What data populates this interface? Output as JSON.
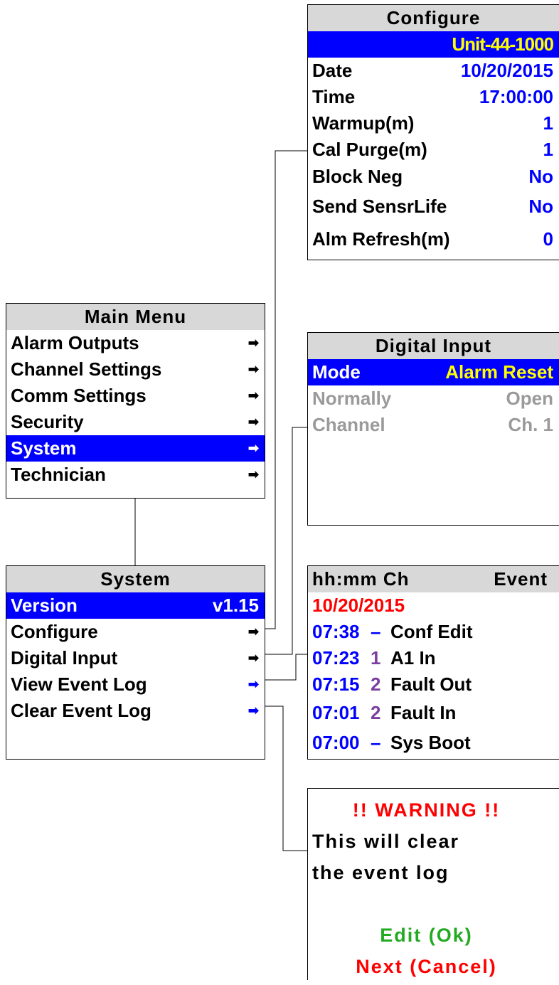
{
  "configure": {
    "title": "Configure",
    "unit_id": "Unit-44-1000",
    "rows": [
      {
        "label": "Date",
        "value": "10/20/2015"
      },
      {
        "label": "Time",
        "value": "17:00:00"
      },
      {
        "label": "Warmup(m)",
        "value": "1"
      },
      {
        "label": "Cal Purge(m)",
        "value": "1"
      },
      {
        "label": "Block Neg",
        "value": "No"
      },
      {
        "label": "Send SensrLife",
        "value": "No"
      },
      {
        "label": "Alm Refresh(m)",
        "value": "0"
      }
    ]
  },
  "main_menu": {
    "title": "Main Menu",
    "items": [
      {
        "label": "Alarm Outputs",
        "arrow": "➡"
      },
      {
        "label": "Channel Settings",
        "arrow": "➡"
      },
      {
        "label": "Comm Settings",
        "arrow": "➡"
      },
      {
        "label": "Security",
        "arrow": "➡"
      },
      {
        "label": "System",
        "arrow": "➡"
      },
      {
        "label": "Technician",
        "arrow": "➡"
      }
    ]
  },
  "system_menu": {
    "title": "System",
    "version_label": "Version",
    "version_value": "v1.15",
    "items": [
      {
        "label": "Configure",
        "arrow": "➡"
      },
      {
        "label": "Digital Input",
        "arrow": "➡"
      },
      {
        "label": "View Event Log",
        "arrow": "➡"
      },
      {
        "label": "Clear Event Log",
        "arrow": "➡"
      }
    ]
  },
  "digital_input": {
    "title": "Digital Input",
    "mode_label": "Mode",
    "mode_value": "Alarm Reset",
    "normally_label": "Normally",
    "normally_value": "Open",
    "channel_label": "Channel",
    "channel_value": "Ch. 1"
  },
  "event_log": {
    "header_left": "hh:mm Ch",
    "header_right": "Event",
    "date": "10/20/2015",
    "entries": [
      {
        "time": "07:38",
        "ch": "–",
        "event": "Conf Edit"
      },
      {
        "time": "07:23",
        "ch": "1",
        "event": "A1 In"
      },
      {
        "time": "07:15",
        "ch": "2",
        "event": "Fault Out"
      },
      {
        "time": "07:01",
        "ch": "2",
        "event": "Fault In"
      },
      {
        "time": "07:00",
        "ch": "–",
        "event": "Sys Boot"
      }
    ]
  },
  "warning": {
    "title": "!! WARNING !!",
    "line1": "This will clear",
    "line2": "the event log",
    "ok": "Edit (Ok)",
    "cancel": "Next (Cancel)"
  },
  "colors": {
    "selection": "#0000ff",
    "header": "#d8d8d8",
    "value_blue": "#0000ff",
    "value_yellow": "#ffff00",
    "warning_red": "#ff0000",
    "ok_green": "#22aa22"
  }
}
